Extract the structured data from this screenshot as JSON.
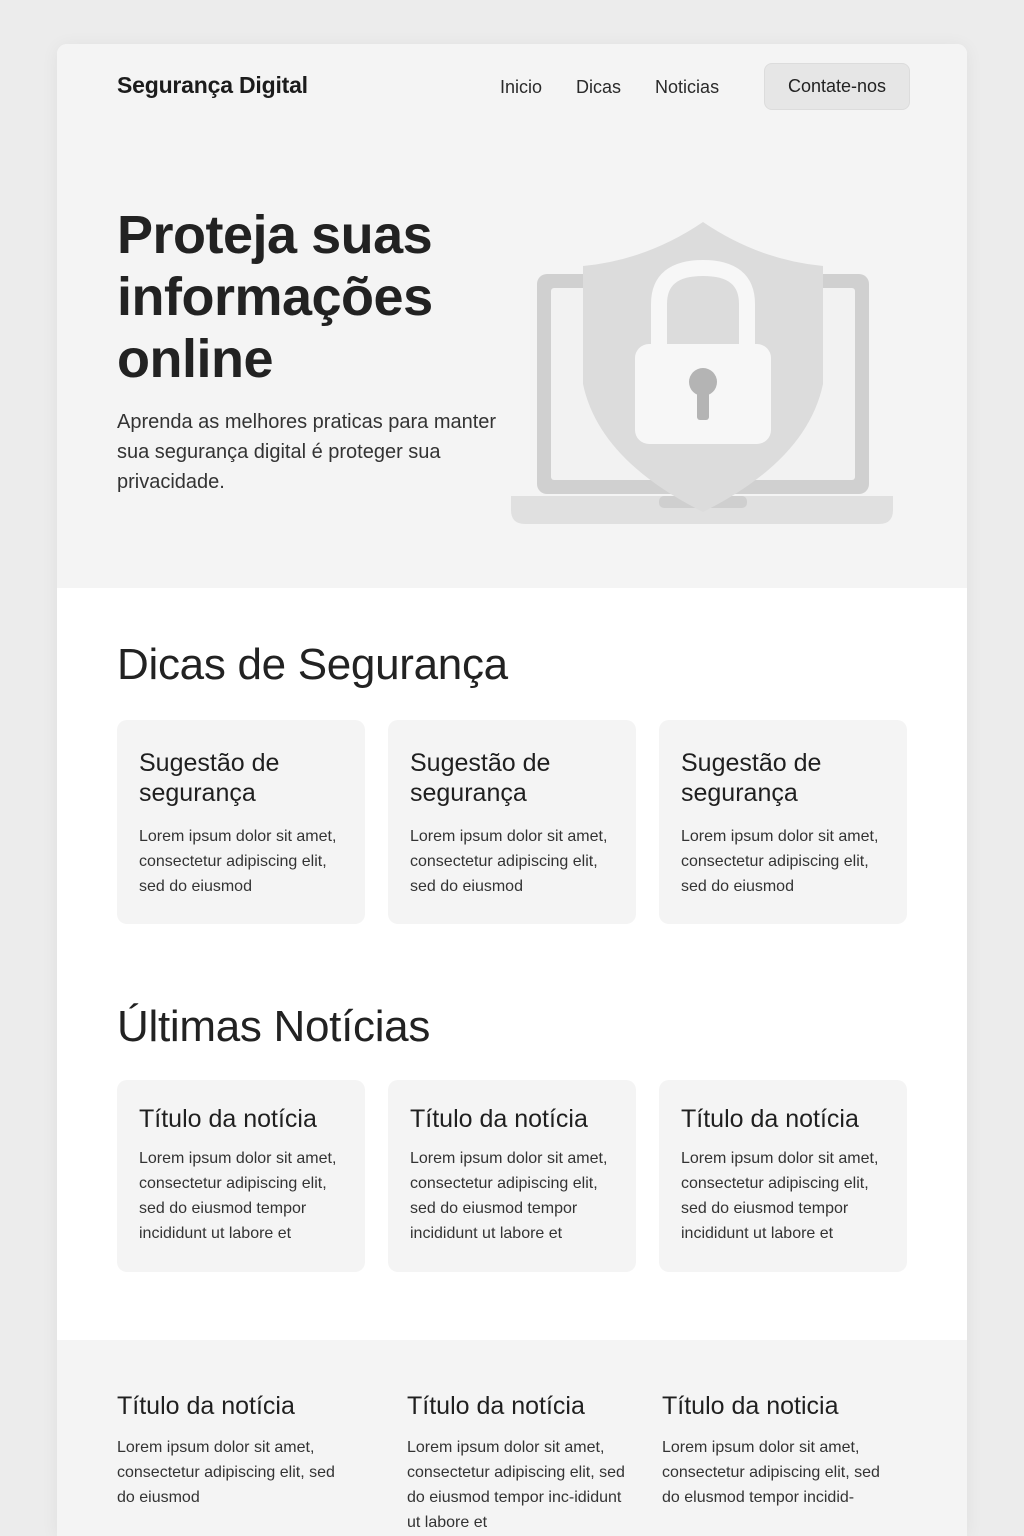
{
  "header": {
    "brand": "Segurança Digital",
    "nav": [
      "Inicio",
      "Dicas",
      "Noticias"
    ],
    "contact_label": "Contate-nos"
  },
  "hero": {
    "title": "Proteja suas informações online",
    "subtitle": "Aprenda as melhores praticas para manter sua segurança digital é proteger sua privacidade.",
    "illustration": "laptop-shield-padlock-icon"
  },
  "tips": {
    "title": "Dicas de Segurança",
    "cards": [
      {
        "title": "Sugestão de segurança",
        "text": "Lorem ipsum dolor sit amet, consectetur adipiscing elit, sed do eiusmod"
      },
      {
        "title": "Sugestão de segurança",
        "text": "Lorem ipsum dolor sit amet, consectetur adipiscing elit, sed do eiusmod"
      },
      {
        "title": "Sugestão de segurança",
        "text": "Lorem ipsum dolor sit amet, consectetur adipiscing elit, sed do eiusmod"
      }
    ]
  },
  "news": {
    "title": "Últimas Notícias",
    "cards": [
      {
        "title": "Título da notícia",
        "text": "Lorem ipsum dolor sit amet, consectetur adipiscing elit, sed do eiusmod tempor incididunt ut labore et"
      },
      {
        "title": "Título da notícia",
        "text": "Lorem ipsum dolor sit amet, consectetur adipiscing elit, sed do eiusmod tempor incididunt ut labore et"
      },
      {
        "title": "Título da notícia",
        "text": "Lorem ipsum dolor sit amet, consectetur adipiscing elit, sed do eiusmod tempor incididunt ut labore et"
      }
    ]
  },
  "bottom": {
    "columns": [
      {
        "title": "Título da notícia",
        "text": "Lorem ipsum dolor sit amet, consectetur adipiscing elit, sed do eiusmod"
      },
      {
        "title": "Título da notícia",
        "text": "Lorem ipsum dolor sit amet, consectetur adipiscing elit, sed do eiusmod tempor inc-ididunt ut labore et"
      },
      {
        "title": "Título da noticia",
        "text": "Lorem ipsum dolor sit amet, consectetur adipiscing elit, sed do elusmod tempor incidid-"
      }
    ]
  },
  "colors": {
    "background": "#ececec",
    "panel": "#f4f4f4",
    "text": "#1e1e1e",
    "button": "#e6e6e6"
  }
}
